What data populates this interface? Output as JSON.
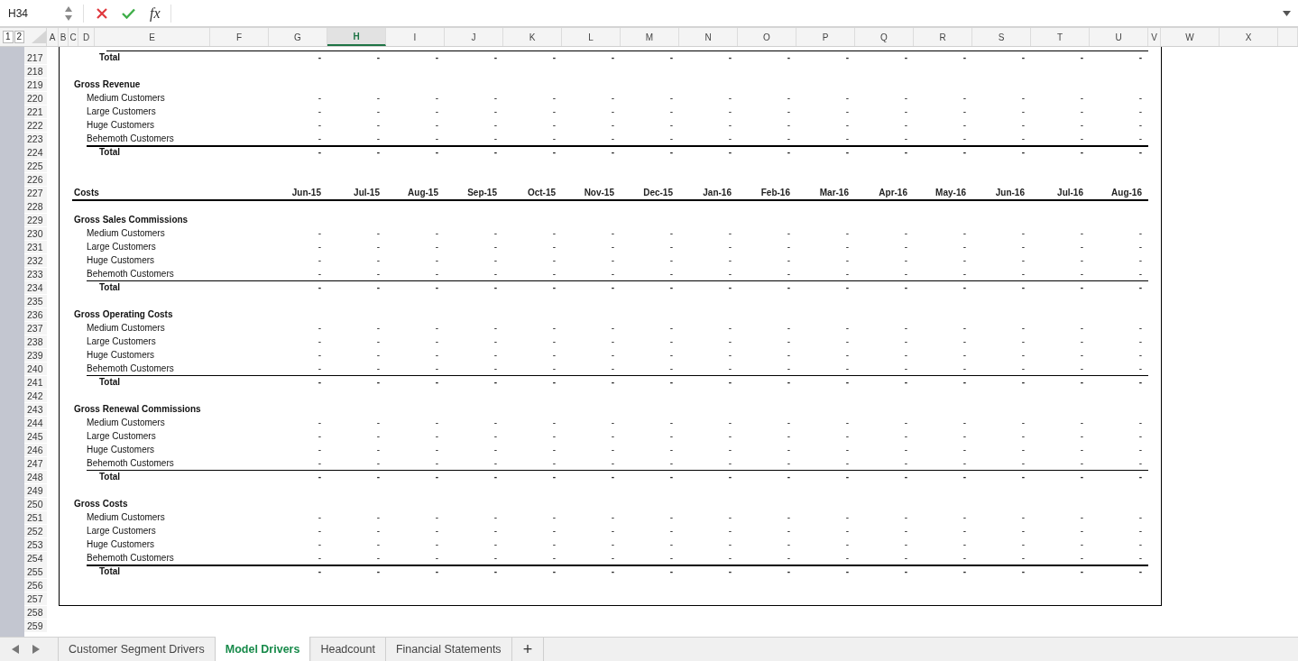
{
  "formula_bar": {
    "name_box": "H34",
    "function_label": "fx"
  },
  "outline_levels": [
    {
      "label": "1"
    },
    {
      "label": "2"
    }
  ],
  "columns": [
    {
      "letter": "A",
      "selected": false
    },
    {
      "letter": "B",
      "selected": false
    },
    {
      "letter": "C",
      "selected": false
    },
    {
      "letter": "D",
      "selected": false
    },
    {
      "letter": "E",
      "selected": false
    },
    {
      "letter": "F",
      "selected": false
    },
    {
      "letter": "G",
      "selected": false
    },
    {
      "letter": "H",
      "selected": true
    },
    {
      "letter": "I",
      "selected": false
    },
    {
      "letter": "J",
      "selected": false
    },
    {
      "letter": "K",
      "selected": false
    },
    {
      "letter": "L",
      "selected": false
    },
    {
      "letter": "M",
      "selected": false
    },
    {
      "letter": "N",
      "selected": false
    },
    {
      "letter": "O",
      "selected": false
    },
    {
      "letter": "P",
      "selected": false
    },
    {
      "letter": "Q",
      "selected": false
    },
    {
      "letter": "R",
      "selected": false
    },
    {
      "letter": "S",
      "selected": false
    },
    {
      "letter": "T",
      "selected": false
    },
    {
      "letter": "U",
      "selected": false
    },
    {
      "letter": "V",
      "selected": false
    },
    {
      "letter": "W",
      "selected": false
    },
    {
      "letter": "X",
      "selected": false
    }
  ],
  "rows": [
    {
      "number": "217",
      "kind": "total",
      "label": "Total",
      "values": [
        "-",
        "-",
        "-",
        "-",
        "-",
        "-",
        "-",
        "-",
        "-",
        "-",
        "-",
        "-",
        "-",
        "-",
        "-"
      ]
    },
    {
      "number": "218",
      "kind": "blank"
    },
    {
      "number": "219",
      "kind": "section",
      "label": "Gross Revenue"
    },
    {
      "number": "220",
      "kind": "item",
      "label": "Medium Customers",
      "values": [
        "-",
        "-",
        "-",
        "-",
        "-",
        "-",
        "-",
        "-",
        "-",
        "-",
        "-",
        "-",
        "-",
        "-",
        "-"
      ]
    },
    {
      "number": "221",
      "kind": "item",
      "label": "Large Customers",
      "values": [
        "-",
        "-",
        "-",
        "-",
        "-",
        "-",
        "-",
        "-",
        "-",
        "-",
        "-",
        "-",
        "-",
        "-",
        "-"
      ]
    },
    {
      "number": "222",
      "kind": "item",
      "label": "Huge Customers",
      "values": [
        "-",
        "-",
        "-",
        "-",
        "-",
        "-",
        "-",
        "-",
        "-",
        "-",
        "-",
        "-",
        "-",
        "-",
        "-"
      ]
    },
    {
      "number": "223",
      "kind": "item",
      "label": "Behemoth Customers",
      "rule_below": true,
      "rule_heavy": true,
      "values": [
        "-",
        "-",
        "-",
        "-",
        "-",
        "-",
        "-",
        "-",
        "-",
        "-",
        "-",
        "-",
        "-",
        "-",
        "-"
      ]
    },
    {
      "number": "224",
      "kind": "total",
      "label": "Total",
      "values": [
        "-",
        "-",
        "-",
        "-",
        "-",
        "-",
        "-",
        "-",
        "-",
        "-",
        "-",
        "-",
        "-",
        "-",
        "-"
      ]
    },
    {
      "number": "225",
      "kind": "blank"
    },
    {
      "number": "226",
      "kind": "blank"
    },
    {
      "number": "227",
      "kind": "header",
      "label": "Costs",
      "rule_below": true,
      "rule_heavy": true,
      "values": [
        "Jun-15",
        "Jul-15",
        "Aug-15",
        "Sep-15",
        "Oct-15",
        "Nov-15",
        "Dec-15",
        "Jan-16",
        "Feb-16",
        "Mar-16",
        "Apr-16",
        "May-16",
        "Jun-16",
        "Jul-16",
        "Aug-16"
      ]
    },
    {
      "number": "228",
      "kind": "blank"
    },
    {
      "number": "229",
      "kind": "section",
      "label": "Gross Sales Commissions"
    },
    {
      "number": "230",
      "kind": "item",
      "label": "Medium Customers",
      "values": [
        "-",
        "-",
        "-",
        "-",
        "-",
        "-",
        "-",
        "-",
        "-",
        "-",
        "-",
        "-",
        "-",
        "-",
        "-"
      ]
    },
    {
      "number": "231",
      "kind": "item",
      "label": "Large Customers",
      "values": [
        "-",
        "-",
        "-",
        "-",
        "-",
        "-",
        "-",
        "-",
        "-",
        "-",
        "-",
        "-",
        "-",
        "-",
        "-"
      ]
    },
    {
      "number": "232",
      "kind": "item",
      "label": "Huge Customers",
      "values": [
        "-",
        "-",
        "-",
        "-",
        "-",
        "-",
        "-",
        "-",
        "-",
        "-",
        "-",
        "-",
        "-",
        "-",
        "-"
      ]
    },
    {
      "number": "233",
      "kind": "item",
      "label": "Behemoth Customers",
      "rule_below": true,
      "rule_heavy": false,
      "values": [
        "-",
        "-",
        "-",
        "-",
        "-",
        "-",
        "-",
        "-",
        "-",
        "-",
        "-",
        "-",
        "-",
        "-",
        "-"
      ]
    },
    {
      "number": "234",
      "kind": "total",
      "label": "Total",
      "values": [
        "-",
        "-",
        "-",
        "-",
        "-",
        "-",
        "-",
        "-",
        "-",
        "-",
        "-",
        "-",
        "-",
        "-",
        "-"
      ]
    },
    {
      "number": "235",
      "kind": "blank"
    },
    {
      "number": "236",
      "kind": "section",
      "label": "Gross Operating Costs"
    },
    {
      "number": "237",
      "kind": "item",
      "label": "Medium Customers",
      "values": [
        "-",
        "-",
        "-",
        "-",
        "-",
        "-",
        "-",
        "-",
        "-",
        "-",
        "-",
        "-",
        "-",
        "-",
        "-"
      ]
    },
    {
      "number": "238",
      "kind": "item",
      "label": "Large Customers",
      "values": [
        "-",
        "-",
        "-",
        "-",
        "-",
        "-",
        "-",
        "-",
        "-",
        "-",
        "-",
        "-",
        "-",
        "-",
        "-"
      ]
    },
    {
      "number": "239",
      "kind": "item",
      "label": "Huge Customers",
      "values": [
        "-",
        "-",
        "-",
        "-",
        "-",
        "-",
        "-",
        "-",
        "-",
        "-",
        "-",
        "-",
        "-",
        "-",
        "-"
      ]
    },
    {
      "number": "240",
      "kind": "item",
      "label": "Behemoth Customers",
      "rule_below": true,
      "rule_heavy": false,
      "values": [
        "-",
        "-",
        "-",
        "-",
        "-",
        "-",
        "-",
        "-",
        "-",
        "-",
        "-",
        "-",
        "-",
        "-",
        "-"
      ]
    },
    {
      "number": "241",
      "kind": "total",
      "label": "Total",
      "values": [
        "-",
        "-",
        "-",
        "-",
        "-",
        "-",
        "-",
        "-",
        "-",
        "-",
        "-",
        "-",
        "-",
        "-",
        "-"
      ]
    },
    {
      "number": "242",
      "kind": "blank"
    },
    {
      "number": "243",
      "kind": "section",
      "label": "Gross Renewal Commissions"
    },
    {
      "number": "244",
      "kind": "item",
      "label": "Medium Customers",
      "values": [
        "-",
        "-",
        "-",
        "-",
        "-",
        "-",
        "-",
        "-",
        "-",
        "-",
        "-",
        "-",
        "-",
        "-",
        "-"
      ]
    },
    {
      "number": "245",
      "kind": "item",
      "label": "Large Customers",
      "values": [
        "-",
        "-",
        "-",
        "-",
        "-",
        "-",
        "-",
        "-",
        "-",
        "-",
        "-",
        "-",
        "-",
        "-",
        "-"
      ]
    },
    {
      "number": "246",
      "kind": "item",
      "label": "Huge Customers",
      "values": [
        "-",
        "-",
        "-",
        "-",
        "-",
        "-",
        "-",
        "-",
        "-",
        "-",
        "-",
        "-",
        "-",
        "-",
        "-"
      ]
    },
    {
      "number": "247",
      "kind": "item",
      "label": "Behemoth Customers",
      "rule_below": true,
      "rule_heavy": false,
      "values": [
        "-",
        "-",
        "-",
        "-",
        "-",
        "-",
        "-",
        "-",
        "-",
        "-",
        "-",
        "-",
        "-",
        "-",
        "-"
      ]
    },
    {
      "number": "248",
      "kind": "total",
      "label": "Total",
      "values": [
        "-",
        "-",
        "-",
        "-",
        "-",
        "-",
        "-",
        "-",
        "-",
        "-",
        "-",
        "-",
        "-",
        "-",
        "-"
      ]
    },
    {
      "number": "249",
      "kind": "blank"
    },
    {
      "number": "250",
      "kind": "section",
      "label": "Gross Costs"
    },
    {
      "number": "251",
      "kind": "item",
      "label": "Medium Customers",
      "values": [
        "-",
        "-",
        "-",
        "-",
        "-",
        "-",
        "-",
        "-",
        "-",
        "-",
        "-",
        "-",
        "-",
        "-",
        "-"
      ]
    },
    {
      "number": "252",
      "kind": "item",
      "label": "Large Customers",
      "values": [
        "-",
        "-",
        "-",
        "-",
        "-",
        "-",
        "-",
        "-",
        "-",
        "-",
        "-",
        "-",
        "-",
        "-",
        "-"
      ]
    },
    {
      "number": "253",
      "kind": "item",
      "label": "Huge Customers",
      "values": [
        "-",
        "-",
        "-",
        "-",
        "-",
        "-",
        "-",
        "-",
        "-",
        "-",
        "-",
        "-",
        "-",
        "-",
        "-"
      ]
    },
    {
      "number": "254",
      "kind": "item",
      "label": "Behemoth Customers",
      "rule_below": true,
      "rule_heavy": true,
      "values": [
        "-",
        "-",
        "-",
        "-",
        "-",
        "-",
        "-",
        "-",
        "-",
        "-",
        "-",
        "-",
        "-",
        "-",
        "-"
      ]
    },
    {
      "number": "255",
      "kind": "total",
      "label": "Total",
      "values": [
        "-",
        "-",
        "-",
        "-",
        "-",
        "-",
        "-",
        "-",
        "-",
        "-",
        "-",
        "-",
        "-",
        "-",
        "-"
      ]
    },
    {
      "number": "256",
      "kind": "blank"
    },
    {
      "number": "257",
      "kind": "blank"
    }
  ],
  "rows_after_group": [
    {
      "number": "258"
    },
    {
      "number": "259"
    }
  ],
  "sheet_tabs": [
    {
      "label": "Customer Segment Drivers",
      "selected": false
    },
    {
      "label": "Model Drivers",
      "selected": true
    },
    {
      "label": "Headcount",
      "selected": false
    },
    {
      "label": "Financial Statements",
      "selected": false
    }
  ],
  "add_sheet": "+"
}
